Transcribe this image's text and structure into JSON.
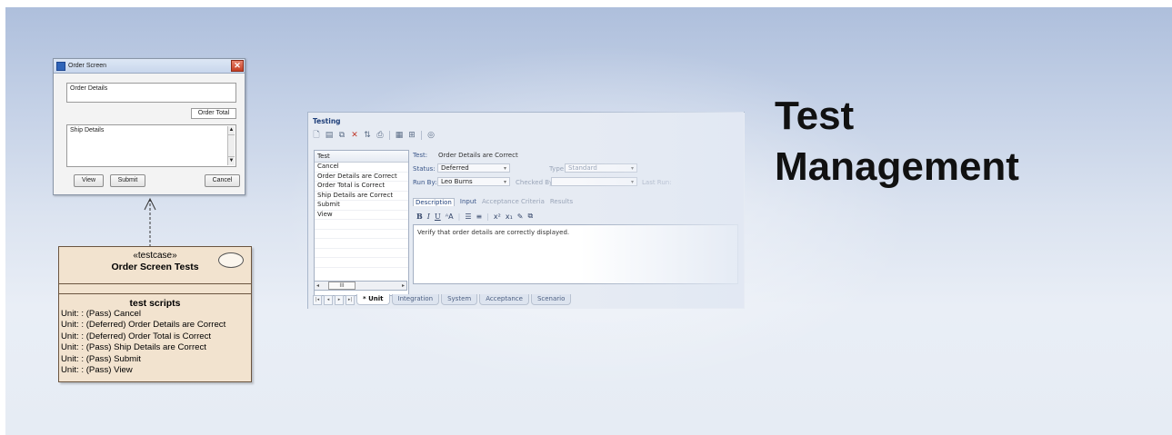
{
  "title": {
    "line1": "Test",
    "line2": "Management"
  },
  "order_screen": {
    "window_title": "Order Screen",
    "order_details": "Order Details",
    "order_total": "Order Total",
    "ship_details": "Ship Details",
    "buttons": {
      "view": "View",
      "submit": "Submit",
      "cancel": "Cancel"
    }
  },
  "testcase": {
    "stereotype": "«testcase»",
    "name": "Order Screen Tests",
    "section_title": "test scripts",
    "scripts": [
      "Unit: : (Pass) Cancel",
      "Unit: : (Deferred) Order Details are Correct",
      "Unit: : (Deferred) Order Total is Correct",
      "Unit: : (Pass) Ship Details are Correct",
      "Unit: : (Pass) Submit",
      "Unit: : (Pass) View"
    ]
  },
  "testing": {
    "window_title": "Testing",
    "list_header": "Test",
    "tests": [
      "Cancel",
      "Order Details are Correct",
      "Order Total is Correct",
      "Ship Details are Correct",
      "Submit",
      "View"
    ],
    "labels": {
      "test": "Test:",
      "status": "Status:",
      "type": "Type:",
      "run_by": "Run By:",
      "checked_by": "Checked By:",
      "last_run": "Last Run:"
    },
    "values": {
      "test": "Order Details are Correct",
      "status": "Deferred",
      "type": "Standard",
      "run_by": "Leo Burns",
      "checked_by": ""
    },
    "detail_tabs": [
      "Description",
      "Input",
      "Acceptance Criteria",
      "Results"
    ],
    "description_text": "Verify that order details are correctly displayed.",
    "scroll_label": "III",
    "bottom_tabs": [
      "* Unit",
      "Integration",
      "System",
      "Acceptance",
      "Scenario"
    ]
  }
}
